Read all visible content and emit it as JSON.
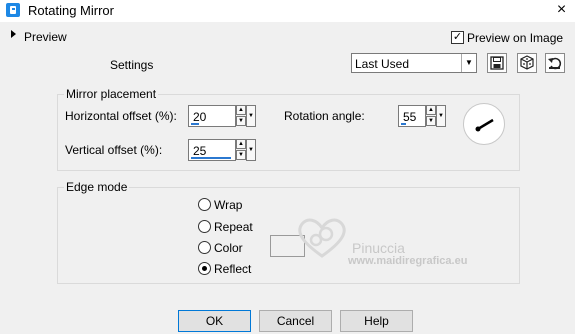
{
  "window": {
    "title": "Rotating Mirror",
    "close_glyph": "×"
  },
  "header": {
    "preview_label": "Preview",
    "preview_on_image_label": "Preview on Image",
    "preview_on_image_checked": true,
    "settings_label": "Settings",
    "preset_value": "Last Used",
    "toolbar_icons": [
      "save-icon",
      "randomize-icon",
      "reset-icon"
    ]
  },
  "mirror_placement": {
    "title": "Mirror placement",
    "horizontal_offset": {
      "label": "Horizontal offset (%):",
      "value": "20",
      "fill_fraction": 0.2
    },
    "vertical_offset": {
      "label": "Vertical offset (%):",
      "value": "25",
      "fill_fraction": 0.25
    },
    "rotation_angle": {
      "label": "Rotation angle:",
      "value": "55",
      "fill_fraction": 0.15
    }
  },
  "edge_mode": {
    "title": "Edge mode",
    "options": [
      "Wrap",
      "Repeat",
      "Color",
      "Reflect"
    ],
    "selected": "Reflect"
  },
  "watermark": {
    "line1": "Pinuccia",
    "line2": "www.maidiregrafica.eu"
  },
  "buttons": {
    "ok": "OK",
    "cancel": "Cancel",
    "help": "Help"
  },
  "colors": {
    "accent": "#0078d7",
    "spin_bar": "#2b78d0"
  }
}
